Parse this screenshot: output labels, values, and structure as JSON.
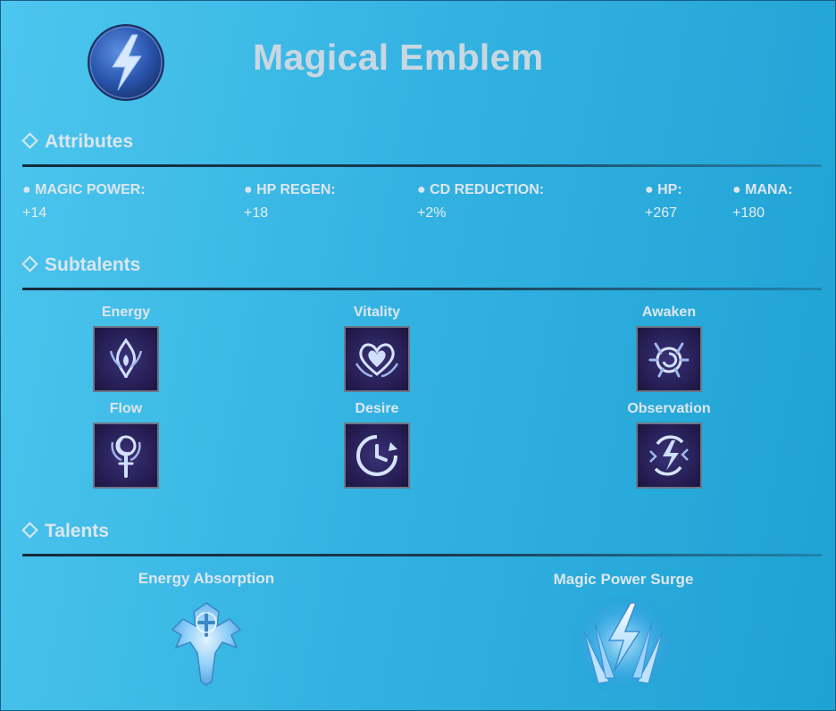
{
  "header": {
    "title": "Magical Emblem",
    "emblem_icon": "lightning-emblem-icon"
  },
  "sections": {
    "attributes": "Attributes",
    "subtalents": "Subtalents",
    "talents": "Talents"
  },
  "attributes": [
    {
      "label": "● MAGIC POWER:",
      "value": "+14"
    },
    {
      "label": "● HP REGEN:",
      "value": "+18"
    },
    {
      "label": "● CD REDUCTION:",
      "value": "+2%"
    },
    {
      "label": "● HP:",
      "value": "+267"
    },
    {
      "label": "● MANA:",
      "value": "+180"
    }
  ],
  "subtalents": [
    {
      "label": "Energy",
      "icon": "energy-icon"
    },
    {
      "label": "Vitality",
      "icon": "vitality-icon"
    },
    {
      "label": "Awaken",
      "icon": "awaken-icon"
    },
    {
      "label": "Flow",
      "icon": "flow-icon"
    },
    {
      "label": "Desire",
      "icon": "desire-icon"
    },
    {
      "label": "Observation",
      "icon": "observation-icon"
    }
  ],
  "talents": [
    {
      "label": "Energy Absorption",
      "icon": "energy-absorption-icon"
    },
    {
      "label": "Magic Power Surge",
      "icon": "magic-power-surge-icon"
    }
  ],
  "colors": {
    "background_start": "#4cc6ee",
    "background_end": "#1ea2d4",
    "title": "#c9d7e2",
    "subtalent_tile": "#251d52",
    "talent_glow": "#7fd0ff"
  }
}
